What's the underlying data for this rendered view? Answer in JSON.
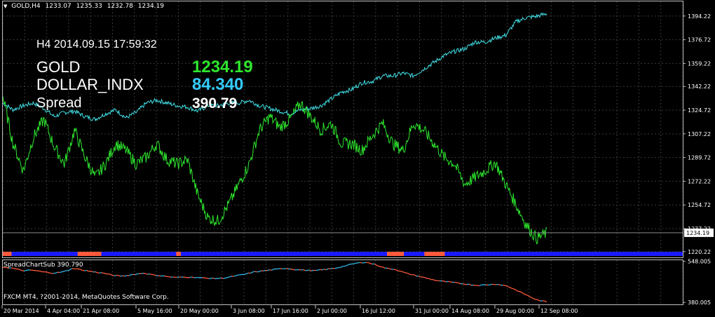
{
  "header": {
    "symbol": "GOLD,H4",
    "open": "1233.07",
    "high": "1235.33",
    "low": "1232.78",
    "close": "1234.19"
  },
  "overlay": {
    "timeframe_date": "H4  2014.09.15 17:59:32",
    "line1_label": "GOLD",
    "line1_value": "1234.19",
    "line2_label": "DOLLAR_INDX",
    "line2_value": "84.340",
    "line3_label": "Spread",
    "line3_value": "390.79"
  },
  "subwindow": {
    "title": "SpreadChartSub 390.790",
    "copyright": "FXCM MT4, ?2001-2014, MetaQuotes Software Corp."
  },
  "colors": {
    "gold_series": "#2ee62e",
    "dollar_series": "#40e0e6",
    "spread_up": "#33b5e5",
    "spread_down": "#ff5a3c",
    "band_blue": "#1a1aff",
    "band_red": "#ff5a3c"
  },
  "chart_data": {
    "type": "line",
    "main": {
      "y_ticks": [
        1394.22,
        1376.72,
        1359.22,
        1342.22,
        1324.72,
        1307.22,
        1289.72,
        1272.22,
        1254.72,
        1237.22,
        1220.22
      ],
      "ylim": [
        1216,
        1405
      ],
      "current_price": "1234.19",
      "grid": true,
      "series": [
        {
          "name": "GOLD",
          "values": [
            1335,
            1300,
            1280,
            1305,
            1318,
            1298,
            1285,
            1310,
            1290,
            1275,
            1285,
            1300,
            1295,
            1285,
            1290,
            1300,
            1288,
            1285,
            1288,
            1262,
            1245,
            1243,
            1255,
            1270,
            1285,
            1310,
            1320,
            1312,
            1318,
            1330,
            1320,
            1310,
            1315,
            1300,
            1300,
            1295,
            1306,
            1315,
            1300,
            1295,
            1315,
            1310,
            1300,
            1290,
            1285,
            1270,
            1275,
            1280,
            1286,
            1270,
            1255,
            1240,
            1230,
            1234
          ]
        },
        {
          "name": "DOLLAR_INDX",
          "values": [
            1330,
            1325,
            1328,
            1330,
            1326,
            1320,
            1323,
            1324,
            1320,
            1318,
            1322,
            1325,
            1319,
            1323,
            1330,
            1332,
            1330,
            1328,
            1327,
            1324,
            1328,
            1328,
            1330,
            1330,
            1332,
            1328,
            1326,
            1324,
            1322,
            1325,
            1326,
            1328,
            1333,
            1338,
            1340,
            1345,
            1346,
            1350,
            1350,
            1352,
            1350,
            1355,
            1360,
            1365,
            1368,
            1370,
            1375,
            1375,
            1378,
            1380,
            1390,
            1393,
            1394,
            1396
          ]
        }
      ]
    },
    "sub": {
      "y_ticks": [
        548.005,
        380.005
      ],
      "ylim": [
        372,
        553
      ],
      "values": [
        525,
        520,
        510,
        512,
        505,
        500,
        505,
        520,
        512,
        505,
        500,
        490,
        488,
        495,
        500,
        492,
        488,
        482,
        484,
        483,
        480,
        478,
        480,
        488,
        495,
        505,
        510,
        515,
        520,
        515,
        512,
        510,
        515,
        520,
        530,
        540,
        545,
        535,
        520,
        515,
        500,
        490,
        480,
        470,
        465,
        460,
        455,
        450,
        452,
        455,
        448,
        430,
        410,
        390,
        382
      ]
    },
    "x_tick_labels": [
      "20 Mar 2014",
      "4 Apr 04:00",
      "21 Apr 08:00",
      "5 May 16:00",
      "20 May 00:00",
      "3 Jun 08:00",
      "17 Jun 16:00",
      "2 Jul 00:00",
      "16 Jul 12:00",
      "31 Jul 00:00",
      "14 Aug 08:00",
      "29 Aug 00:00",
      "12 Sep 08:00"
    ],
    "band_segments": [
      {
        "start": 0.0,
        "end": 0.013,
        "color": "red"
      },
      {
        "start": 0.013,
        "end": 0.11,
        "color": "blue"
      },
      {
        "start": 0.11,
        "end": 0.145,
        "color": "red"
      },
      {
        "start": 0.145,
        "end": 0.255,
        "color": "blue"
      },
      {
        "start": 0.255,
        "end": 0.262,
        "color": "red"
      },
      {
        "start": 0.262,
        "end": 0.565,
        "color": "blue"
      },
      {
        "start": 0.565,
        "end": 0.59,
        "color": "red"
      },
      {
        "start": 0.59,
        "end": 0.62,
        "color": "blue"
      },
      {
        "start": 0.62,
        "end": 0.65,
        "color": "red"
      },
      {
        "start": 0.65,
        "end": 1.0,
        "color": "blue"
      }
    ]
  }
}
